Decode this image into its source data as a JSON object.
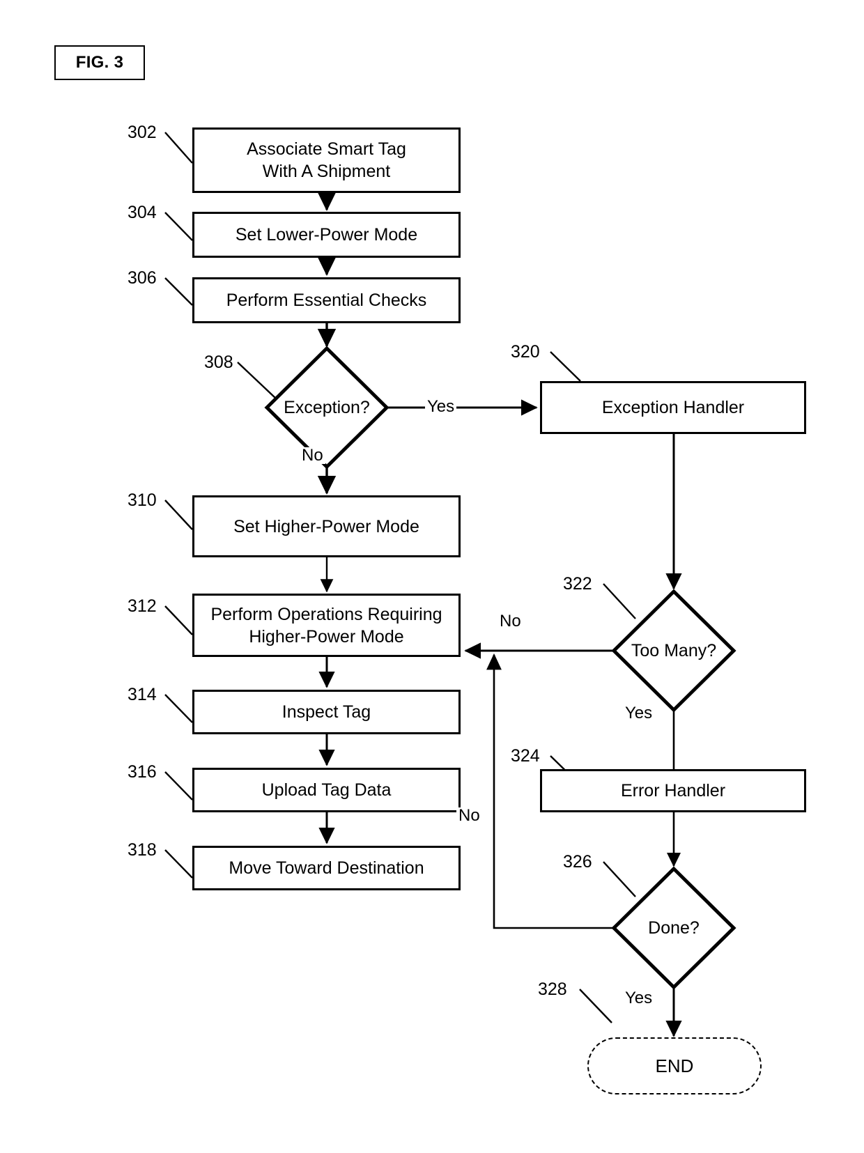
{
  "figure": {
    "label": "FIG. 3"
  },
  "diagram": {
    "type": "flowchart",
    "title": "FIG. 3",
    "nodes": [
      {
        "id": "302",
        "ref": "302",
        "shape": "process",
        "lines": [
          "Associate Smart Tag",
          "With A Shipment"
        ],
        "text": "Associate Smart Tag With A Shipment"
      },
      {
        "id": "304",
        "ref": "304",
        "shape": "process",
        "lines": [
          "Set Lower-Power Mode"
        ],
        "text": "Set Lower-Power Mode"
      },
      {
        "id": "306",
        "ref": "306",
        "shape": "process",
        "lines": [
          "Perform Essential Checks"
        ],
        "text": "Perform Essential Checks"
      },
      {
        "id": "308",
        "ref": "308",
        "shape": "decision",
        "lines": [
          "Exception?"
        ],
        "text": "Exception?"
      },
      {
        "id": "310",
        "ref": "310",
        "shape": "process",
        "lines": [
          "Set Higher-Power Mode"
        ],
        "text": "Set Higher-Power Mode"
      },
      {
        "id": "312",
        "ref": "312",
        "shape": "process",
        "lines": [
          "Perform Operations Requiring",
          "Higher-Power Mode"
        ],
        "text": "Perform Operations Requiring Higher-Power Mode"
      },
      {
        "id": "314",
        "ref": "314",
        "shape": "process",
        "lines": [
          "Inspect Tag"
        ],
        "text": "Inspect Tag"
      },
      {
        "id": "316",
        "ref": "316",
        "shape": "process",
        "lines": [
          "Upload Tag Data"
        ],
        "text": "Upload Tag Data"
      },
      {
        "id": "318",
        "ref": "318",
        "shape": "process",
        "lines": [
          "Move Toward Destination"
        ],
        "text": "Move Toward Destination"
      },
      {
        "id": "320",
        "ref": "320",
        "shape": "process",
        "lines": [
          "Exception Handler"
        ],
        "text": "Exception Handler"
      },
      {
        "id": "322",
        "ref": "322",
        "shape": "decision",
        "lines": [
          "Too Many?"
        ],
        "text": "Too Many?"
      },
      {
        "id": "324",
        "ref": "324",
        "shape": "process",
        "lines": [
          "Error Handler"
        ],
        "text": "Error Handler"
      },
      {
        "id": "326",
        "ref": "326",
        "shape": "decision",
        "lines": [
          "Done?"
        ],
        "text": "Done?"
      },
      {
        "id": "328",
        "ref": "328",
        "shape": "terminator",
        "lines": [
          "END"
        ],
        "text": "END"
      }
    ],
    "edges": [
      {
        "from": "302",
        "to": "304",
        "label": ""
      },
      {
        "from": "304",
        "to": "306",
        "label": ""
      },
      {
        "from": "306",
        "to": "308",
        "label": ""
      },
      {
        "from": "308",
        "to": "320",
        "label": "Yes"
      },
      {
        "from": "308",
        "to": "310",
        "label": "No"
      },
      {
        "from": "310",
        "to": "312",
        "label": ""
      },
      {
        "from": "312",
        "to": "314",
        "label": ""
      },
      {
        "from": "314",
        "to": "316",
        "label": ""
      },
      {
        "from": "316",
        "to": "318",
        "label": ""
      },
      {
        "from": "320",
        "to": "322",
        "label": ""
      },
      {
        "from": "322",
        "to": "312",
        "label": "No"
      },
      {
        "from": "322",
        "to": "324",
        "label": "Yes"
      },
      {
        "from": "324",
        "to": "326",
        "label": ""
      },
      {
        "from": "326",
        "to": "312",
        "label": "No"
      },
      {
        "from": "326",
        "to": "328",
        "label": "Yes"
      }
    ],
    "edge_labels": {
      "exception_yes": "Yes",
      "exception_no": "No",
      "too_many_no": "No",
      "too_many_yes": "Yes",
      "done_no": "No",
      "done_yes": "Yes"
    },
    "refs": {
      "n302": "302",
      "n304": "304",
      "n306": "306",
      "n308": "308",
      "n310": "310",
      "n312": "312",
      "n314": "314",
      "n316": "316",
      "n318": "318",
      "n320": "320",
      "n322": "322",
      "n324": "324",
      "n326": "326",
      "n328": "328"
    },
    "colors": {
      "stroke": "#000000",
      "fill": "#ffffff"
    }
  }
}
